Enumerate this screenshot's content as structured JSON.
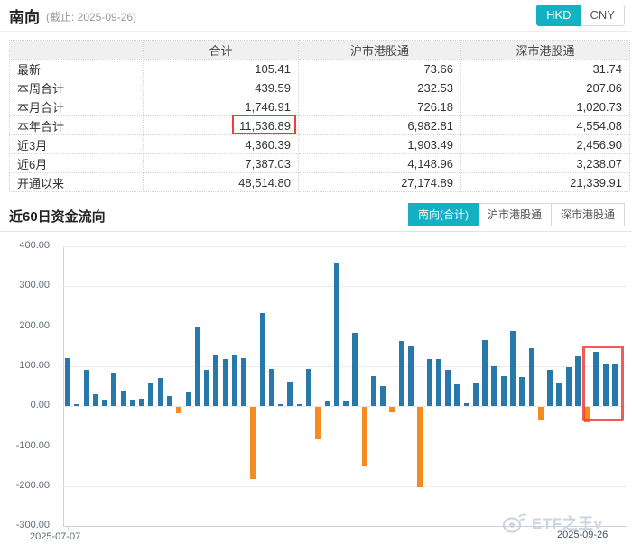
{
  "header": {
    "title": "南向",
    "subtitle": "(截止: 2025-09-26)",
    "currency_tabs": [
      {
        "label": "HKD",
        "active": true
      },
      {
        "label": "CNY",
        "active": false
      }
    ]
  },
  "table": {
    "columns": [
      "",
      "合计",
      "沪市港股通",
      "深市港股通"
    ],
    "rows": [
      {
        "label": "最新",
        "values": [
          "105.41",
          "73.66",
          "31.74"
        ]
      },
      {
        "label": "本周合计",
        "values": [
          "439.59",
          "232.53",
          "207.06"
        ]
      },
      {
        "label": "本月合计",
        "values": [
          "1,746.91",
          "726.18",
          "1,020.73"
        ]
      },
      {
        "label": "本年合计",
        "values": [
          "11,536.89",
          "6,982.81",
          "4,554.08"
        ],
        "highlighted_value_index": 0
      },
      {
        "label": "近3月",
        "values": [
          "4,360.39",
          "1,903.49",
          "2,456.90"
        ]
      },
      {
        "label": "近6月",
        "values": [
          "7,387.03",
          "4,148.96",
          "3,238.07"
        ]
      },
      {
        "label": "开通以来",
        "values": [
          "48,514.80",
          "27,174.89",
          "21,339.91"
        ]
      }
    ]
  },
  "flow_section": {
    "title": "近60日资金流向",
    "tabs": [
      {
        "label": "南向(合计)",
        "active": true
      },
      {
        "label": "沪市港股通",
        "active": false
      },
      {
        "label": "深市港股通",
        "active": false
      }
    ]
  },
  "chart_data": {
    "type": "bar",
    "title": "近60日资金流向",
    "ylim": [
      -300,
      400
    ],
    "y_ticks": [
      "400.00",
      "300.00",
      "200.00",
      "100.00",
      "0.00",
      "-100.00",
      "-200.00",
      "-300.00"
    ],
    "x_first_label": "2025-07-07",
    "x_last_label": "2025-09-26",
    "grid": true,
    "positive_color": "#2878a9",
    "negative_color": "#f68b1f",
    "values": [
      120,
      5,
      92,
      29,
      16,
      82,
      39,
      16,
      19,
      59,
      71,
      26,
      -16,
      37,
      200,
      90,
      126,
      117,
      129,
      120,
      -180,
      232,
      93,
      6,
      61,
      6,
      93,
      -81,
      11,
      357,
      13,
      183,
      -145,
      75,
      50,
      -12,
      163,
      150,
      -201,
      119,
      119,
      90,
      55,
      7,
      57,
      166,
      100,
      75,
      187,
      72,
      145,
      -31,
      91,
      58,
      97,
      125,
      -38,
      135,
      106,
      105.41
    ],
    "highlight_last_n": 3
  },
  "watermark": {
    "text": "ETF之王v"
  },
  "colors": {
    "accent_teal": "#14b1c3",
    "bar_inflow_blue": "#2878a9",
    "bar_outflow_orange": "#f68b1f",
    "annotation_red": "#ed3e3a"
  }
}
